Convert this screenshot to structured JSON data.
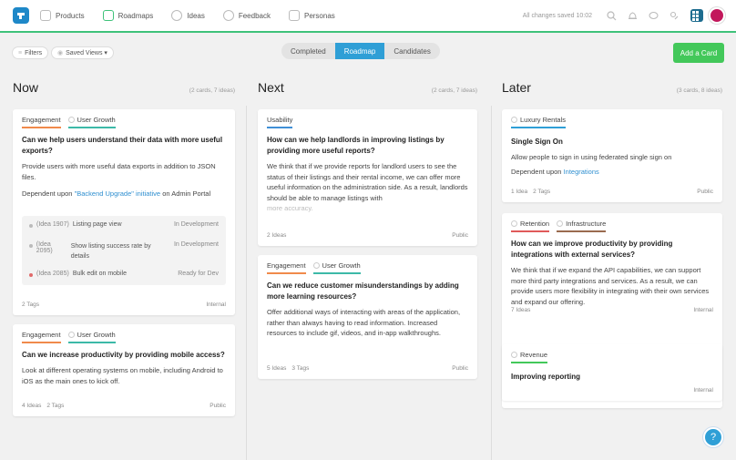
{
  "nav": {
    "items": [
      {
        "label": "Products",
        "icon": "cube-icon"
      },
      {
        "label": "Roadmaps",
        "icon": "roadmap-icon"
      },
      {
        "label": "Ideas",
        "icon": "lightbulb-icon"
      },
      {
        "label": "Feedback",
        "icon": "chat-icon"
      },
      {
        "label": "Personas",
        "icon": "persona-icon"
      }
    ],
    "saved_status": "All changes saved 10:02"
  },
  "toolbar": {
    "filters_label": "Filters",
    "saved_views_label": "Saved Views ▾",
    "segments": [
      "Completed",
      "Roadmap",
      "Candidates"
    ],
    "active_segment": "Roadmap",
    "add_card_label": "Add a Card"
  },
  "colors": {
    "accent": "#2f9fd6",
    "green": "#43c85a",
    "engagement": "#f08a4b",
    "user_growth": "#3cb9a8",
    "usability": "#3f8fd6",
    "retention": "#e05a5a",
    "infrastructure": "#9a6b4f",
    "revenue": "#43c85a",
    "luxury": "#2f9fd6"
  },
  "columns": {
    "now": {
      "title": "Now",
      "count": "(2 cards, 7 ideas)",
      "cards": [
        {
          "tags": [
            "Engagement",
            "User Growth"
          ],
          "title": "Can we help users understand their data with more useful exports?",
          "desc": "Provide users with more useful data exports in addition to JSON files.",
          "dep_prefix": "Dependent upon ",
          "dep_link": "\"Backend Upgrade\" initiative",
          "dep_suffix": " on Admin Portal",
          "deps": [
            {
              "id": "(Idea 1907)",
              "name": "Listing page view",
              "status": "In Development"
            },
            {
              "id": "(Idea 2095)",
              "name": "Show listing success rate by details",
              "status": "In Development"
            },
            {
              "id": "(Idea 2085)",
              "name": "Bulk edit on mobile",
              "status": "Ready for Dev"
            }
          ],
          "foot": "2 Tags",
          "visibility": "Internal"
        },
        {
          "tags": [
            "Engagement",
            "User Growth"
          ],
          "title": "Can we increase productivity by providing mobile access?",
          "desc": "Look at different operating systems on mobile, including Android to iOS as the main ones to kick off.",
          "foot_ideas": "4 Ideas",
          "foot_tags": "2 Tags",
          "visibility": "Public"
        }
      ]
    },
    "next": {
      "title": "Next",
      "count": "(2 cards, 7 ideas)",
      "cards": [
        {
          "tags": [
            "Usability"
          ],
          "title": "How can we help landlords in improving listings by providing more useful reports?",
          "desc": "We think that if we provide reports for landlord users to see the status of their listings and their rental income, we can offer more useful information on the administration side. As a result, landlords should be able to manage listings with",
          "desc_fade": "more accuracy.",
          "foot": "2 Ideas",
          "visibility": "Public"
        },
        {
          "tags": [
            "Engagement",
            "User Growth"
          ],
          "title": "Can we reduce customer misunderstandings by adding more learning resources?",
          "desc": "Offer additional ways of interacting with areas of the application, rather than always having to read information. Increased resources to include gif, videos, and in-app walkthroughs.",
          "foot_ideas": "5 Ideas",
          "foot_tags": "3 Tags",
          "visibility": "Public"
        }
      ]
    },
    "later": {
      "title": "Later",
      "count": "(3 cards, 8 ideas)",
      "cards": [
        {
          "tags": [
            "Luxury Rentals"
          ],
          "title": "Single Sign On",
          "desc": "Allow people to sign in using federated single sign on",
          "dep_prefix": "Dependent upon ",
          "dep_link": "Integrations",
          "foot_ideas": "1 Idea",
          "foot_tags": "2 Tags",
          "visibility": "Public"
        },
        {
          "tags": [
            "Retention",
            "Infrastructure"
          ],
          "title": "How can we improve productivity by providing integrations with external services?",
          "desc": "We think that if we expand the API capabilities, we can support more third party integrations and services. As a result, we can provide users more flexibility in integrating with their own services and expand our offering.",
          "foot": "7 Ideas",
          "visibility": "Internal"
        },
        {
          "tags": [
            "Revenue"
          ],
          "title": "Improving reporting",
          "visibility": "Internal"
        }
      ]
    }
  }
}
